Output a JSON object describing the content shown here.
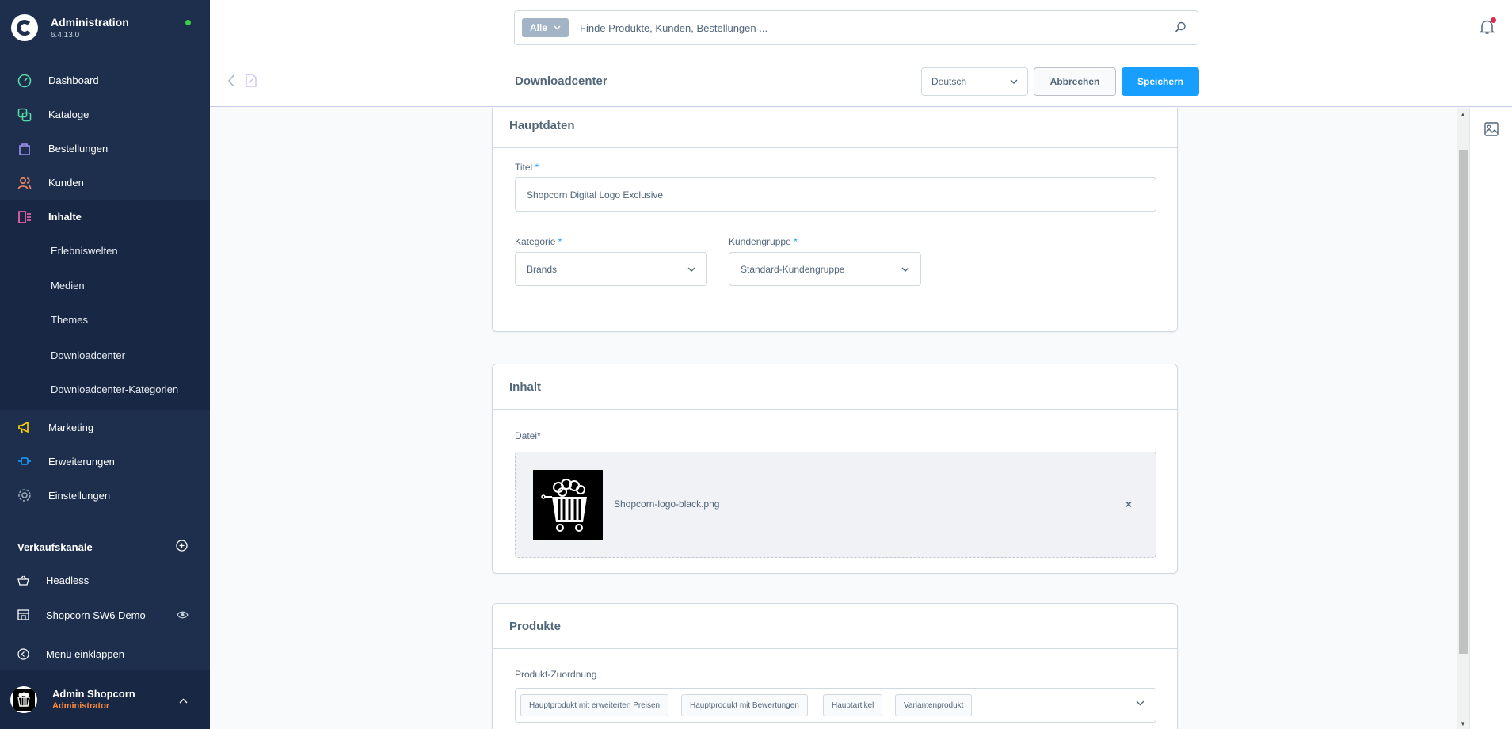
{
  "sidebar": {
    "brand_title": "Administration",
    "brand_version": "6.4.13.0",
    "nav": [
      {
        "label": "Dashboard",
        "icon": "dashboard-icon",
        "color": "#57d9a3"
      },
      {
        "label": "Kataloge",
        "icon": "catalog-icon",
        "color": "#57d9a3"
      },
      {
        "label": "Bestellungen",
        "icon": "orders-icon",
        "color": "#a092f0"
      },
      {
        "label": "Kunden",
        "icon": "customers-icon",
        "color": "#f88962"
      },
      {
        "label": "Inhalte",
        "icon": "content-icon",
        "color": "#ff68b4"
      }
    ],
    "sub": [
      "Erlebniswelten",
      "Medien",
      "Themes",
      "Downloadcenter",
      "Downloadcenter-Kategorien"
    ],
    "nav2": [
      {
        "label": "Marketing",
        "icon": "marketing-icon",
        "color": "#ffd700"
      },
      {
        "label": "Erweiterungen",
        "icon": "extensions-icon",
        "color": "#189eff"
      },
      {
        "label": "Einstellungen",
        "icon": "settings-icon",
        "color": "#9aa8b5"
      }
    ],
    "channels_title": "Verkaufskanäle",
    "channels": [
      {
        "label": "Headless",
        "icon": "basket-icon"
      },
      {
        "label": "Shopcorn SW6 Demo",
        "icon": "storefront-icon"
      }
    ],
    "collapse_label": "Menü einklappen",
    "user_name": "Admin Shopcorn",
    "user_role": "Administrator"
  },
  "search": {
    "type_label": "Alle",
    "placeholder": "Finde Produkte, Kunden, Bestellungen ..."
  },
  "smartbar": {
    "title": "Downloadcenter",
    "language": "Deutsch",
    "cancel_label": "Abbrechen",
    "save_label": "Speichern"
  },
  "main": {
    "card1": {
      "title": "Hauptdaten",
      "title_label": "Titel",
      "title_value": "Shopcorn Digital Logo Exclusive",
      "category_label": "Kategorie",
      "category_value": "Brands",
      "customer_group_label": "Kundengruppe",
      "customer_group_value": "Standard-Kundengruppe",
      "required_mark": "*"
    },
    "card2": {
      "title": "Inhalt",
      "file_label": "Datei*",
      "file_name": "Shopcorn-logo-black.png",
      "remove_label": "×"
    },
    "card3": {
      "title": "Produkte",
      "assignment_label": "Produkt-Zuordnung",
      "tags": [
        "Hauptprodukt mit erweiterten Preisen",
        "Hauptprodukt mit Bewertungen",
        "Hauptartikel",
        "Variantenprodukt"
      ]
    }
  },
  "colors": {
    "sidebar_bg": "#1d2f4d",
    "primary": "#189eff",
    "role": "#f88b3f",
    "online": "#37d046"
  }
}
